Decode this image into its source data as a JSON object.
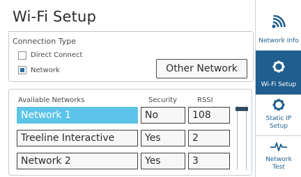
{
  "title": "Wi-Fi Setup",
  "connection": {
    "label": "Connection Type",
    "options": [
      {
        "label": "Direct Connect",
        "checked": false
      },
      {
        "label": "Network",
        "checked": true
      }
    ],
    "other_button": "Other Network"
  },
  "networks": {
    "headers": {
      "name": "Available Networks",
      "security": "Security",
      "rssi": "RSSI"
    },
    "rows": [
      {
        "name": "Network 1",
        "security": "No",
        "rssi": "108",
        "selected": true
      },
      {
        "name": "Treeline Interactive",
        "security": "Yes",
        "rssi": "2",
        "selected": false
      },
      {
        "name": "Network 2",
        "security": "Yes",
        "rssi": "3",
        "selected": false
      }
    ]
  },
  "sidenav": {
    "items": [
      {
        "label": "Network Info",
        "icon": "wifi-icon",
        "active": false
      },
      {
        "label": "Wi-Fi Setup",
        "icon": "gear-icon",
        "active": true
      },
      {
        "label_line1": "Static IP",
        "label_line2": "Setup",
        "icon": "gear-icon",
        "active": false
      },
      {
        "label_line1": "Network",
        "label_line2": "Test",
        "icon": "pulse-icon",
        "active": false
      }
    ]
  },
  "colors": {
    "accent": "#1f5e8e",
    "selected_row": "#5cc4e8",
    "checkbox_fill": "#2a6ea6"
  }
}
